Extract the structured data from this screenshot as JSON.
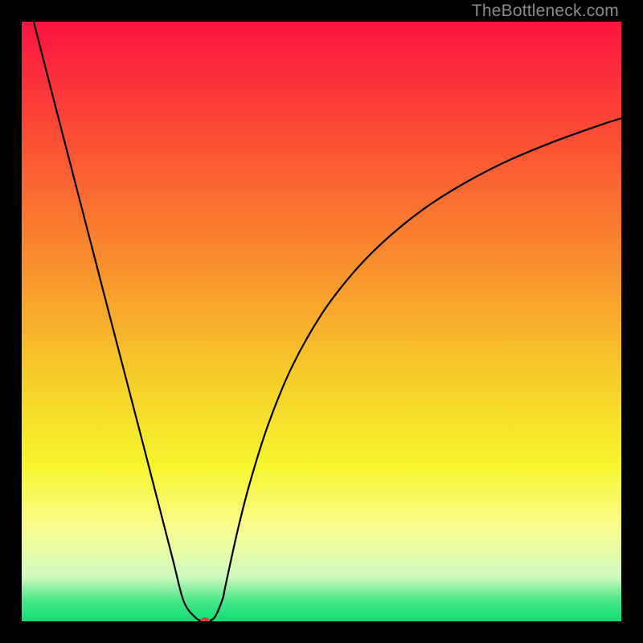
{
  "watermark": "TheBottleneck.com",
  "chart_data": {
    "type": "line",
    "title": "",
    "xlabel": "",
    "ylabel": "",
    "xlim": [
      0,
      100
    ],
    "ylim": [
      0,
      100
    ],
    "grid": false,
    "legend": false,
    "background": {
      "style": "vertical-gradient",
      "stops": [
        {
          "offset": 0.0,
          "color": "#fb1440"
        },
        {
          "offset": 0.2,
          "color": "#fb5035"
        },
        {
          "offset": 0.4,
          "color": "#f98e2e"
        },
        {
          "offset": 0.6,
          "color": "#f5cf2a"
        },
        {
          "offset": 0.74,
          "color": "#f6f52e"
        },
        {
          "offset": 0.84,
          "color": "#fafc8c"
        },
        {
          "offset": 0.925,
          "color": "#d1fac0"
        },
        {
          "offset": 0.965,
          "color": "#4de78a"
        },
        {
          "offset": 1.0,
          "color": "#09df72"
        }
      ]
    },
    "series": [
      {
        "name": "bottleneck-curve",
        "color": "#000000",
        "x": [
          2.0,
          5,
          10,
          15,
          20,
          25,
          27,
          29,
          30.2,
          31,
          32.2,
          33.5,
          34,
          36,
          38,
          41,
          45,
          50,
          55,
          60,
          66,
          72,
          80,
          88,
          96,
          100
        ],
        "y": [
          100,
          88.3,
          69.0,
          49.7,
          30.5,
          11.1,
          3.4,
          0.6,
          0.0,
          0.0,
          0.7,
          3.7,
          6.0,
          15.1,
          22.9,
          32.5,
          42.3,
          51.2,
          57.8,
          63.0,
          68.0,
          72.0,
          76.3,
          79.7,
          82.6,
          83.9
        ]
      }
    ],
    "marker": {
      "name": "optimal-point",
      "x": 30.6,
      "y": 0.0,
      "color": "#d24a3f",
      "rx": 6,
      "ry": 5
    }
  }
}
